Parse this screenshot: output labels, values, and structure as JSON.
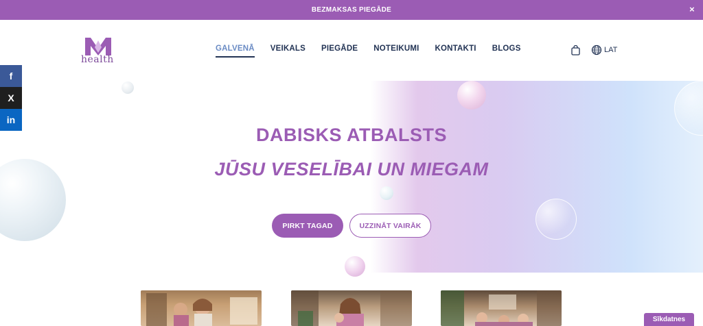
{
  "announcement": {
    "text": "BEZMAKSAS PIEGĀDE",
    "close_glyph": "×"
  },
  "logo": {
    "mark": "M",
    "word": "health",
    "color": "#9b5cb4"
  },
  "nav": {
    "items": [
      {
        "label": "GALVENĀ",
        "active": true
      },
      {
        "label": "VEIKALS",
        "active": false
      },
      {
        "label": "PIEGĀDE",
        "active": false
      },
      {
        "label": "NOTEIKUMI",
        "active": false
      },
      {
        "label": "KONTAKTI",
        "active": false
      },
      {
        "label": "BLOGS",
        "active": false
      }
    ]
  },
  "header_actions": {
    "cart_icon": "shopping-bag-icon",
    "globe_icon": "globe-icon",
    "language": "LAT"
  },
  "social": [
    {
      "name": "facebook",
      "glyph": "f"
    },
    {
      "name": "x",
      "glyph": "X"
    },
    {
      "name": "linkedin",
      "glyph": "in"
    }
  ],
  "hero": {
    "title": "DABISKS ATBALSTS",
    "subtitle": "JŪSU VESELĪBAI UN MIEGAM",
    "primary_button": "PIRKT TAGAD",
    "secondary_button": "UZZINĀT VAIRĀK"
  },
  "cookie_tab": {
    "label": "Sīkdatnes"
  },
  "colors": {
    "brand": "#9b5cb4",
    "nav_text": "#223354",
    "active_nav": "#6a8bc4"
  }
}
